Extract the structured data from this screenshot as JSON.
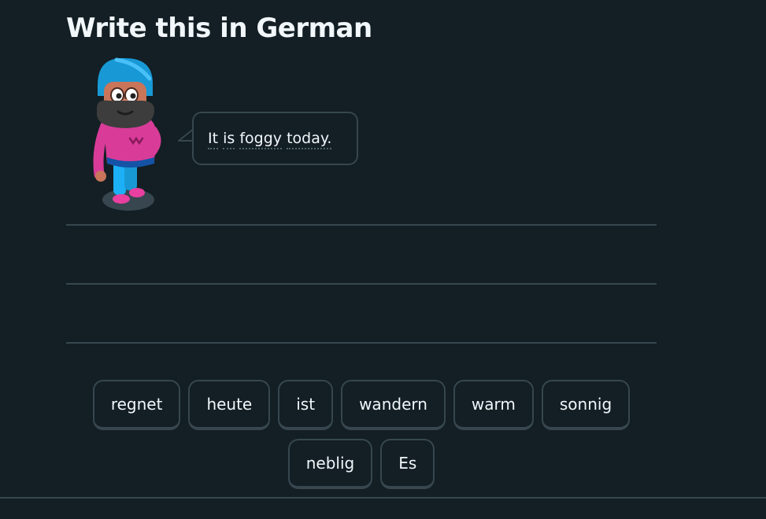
{
  "exercise": {
    "title": "Write this in German",
    "prompt_words": [
      "It",
      "is",
      "foggy",
      "today."
    ],
    "answer_lines": 3
  },
  "word_bank": {
    "row1": [
      "regnet",
      "heute",
      "ist",
      "wandern",
      "warm",
      "sonnig"
    ],
    "row2": [
      "neblig",
      "Es"
    ]
  },
  "character": {
    "icon": "speaker-character-icon"
  },
  "colors": {
    "background": "#131f24",
    "border": "#37464f",
    "text": "#f1f7fb"
  }
}
